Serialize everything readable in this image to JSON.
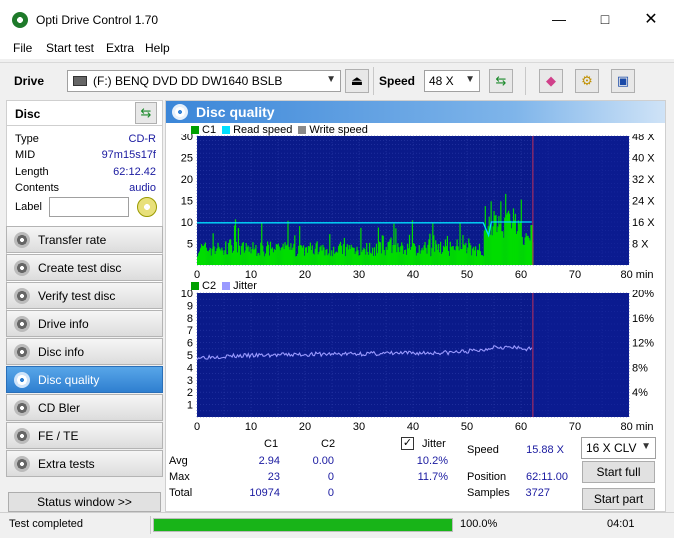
{
  "window": {
    "title": "Opti Drive Control 1.70"
  },
  "menu": [
    "File",
    "Start test",
    "Extra",
    "Help"
  ],
  "toolbar": {
    "drive_label": "Drive",
    "drive_value": "(F:)  BENQ DVD DD DW1640 BSLB",
    "speed_label": "Speed",
    "speed_value": "48 X"
  },
  "disc": {
    "header": "Disc",
    "rows": [
      {
        "key": "Type",
        "value": "CD-R"
      },
      {
        "key": "MID",
        "value": "97m15s17f"
      },
      {
        "key": "Length",
        "value": "62:12.42"
      },
      {
        "key": "Contents",
        "value": "audio"
      }
    ],
    "label_key": "Label",
    "label_value": ""
  },
  "nav": [
    "Transfer rate",
    "Create test disc",
    "Verify test disc",
    "Drive info",
    "Disc info",
    "Disc quality",
    "CD Bler",
    "FE / TE",
    "Extra tests"
  ],
  "nav_active": 5,
  "status_window_label": "Status window >>",
  "panel_title": "Disc quality",
  "legend_top": {
    "c1": "C1",
    "read": "Read speed",
    "write": "Write speed"
  },
  "legend_bottom": {
    "c2": "C2",
    "jitter": "Jitter"
  },
  "colors": {
    "accent": "#2f7fd0",
    "c1": "#00dd00",
    "read_speed": "#00e0ff",
    "jitter": "#9a9aff",
    "plot_bg": "#0a1a8a",
    "progress": "#18b418"
  },
  "chart_data": [
    {
      "type": "area",
      "series": [
        {
          "name": "C1",
          "color": "#00dd00"
        },
        {
          "name": "Read speed",
          "color": "#00e0ff"
        },
        {
          "name": "Write speed",
          "color": "#9a9a9a"
        }
      ],
      "x_ticks": [
        "0",
        "10",
        "20",
        "30",
        "40",
        "50",
        "60",
        "70",
        "80 min"
      ],
      "y_left_ticks": [
        "5",
        "10",
        "15",
        "20",
        "25",
        "30"
      ],
      "y_right_ticks": [
        "8 X",
        "16 X",
        "24 X",
        "32 X",
        "40 X",
        "48 X"
      ],
      "xlim": [
        0,
        80
      ],
      "ylim": [
        0,
        30
      ],
      "disc_end_min": 62.2,
      "c1_summary": {
        "avg": 2.94,
        "max": 23,
        "max_at_min": 55
      },
      "read_speed_x": [
        [
          0,
          15.7
        ],
        [
          53,
          15.7
        ],
        [
          54,
          11.0
        ],
        [
          54.5,
          16.0
        ],
        [
          62,
          16.0
        ]
      ]
    },
    {
      "type": "line",
      "series": [
        {
          "name": "C2",
          "color": "#00dd00"
        },
        {
          "name": "Jitter",
          "color": "#9a9aff"
        }
      ],
      "x_ticks": [
        "0",
        "10",
        "20",
        "30",
        "40",
        "50",
        "60",
        "70",
        "80 min"
      ],
      "y_left_ticks": [
        "1",
        "2",
        "3",
        "4",
        "5",
        "6",
        "7",
        "8",
        "9",
        "10"
      ],
      "y_right_ticks": [
        "4%",
        "8%",
        "12%",
        "16%",
        "20%"
      ],
      "xlim": [
        0,
        80
      ],
      "ylim": [
        0,
        10
      ],
      "disc_end_min": 62.2,
      "jitter_pct": [
        [
          0,
          9.6
        ],
        [
          5,
          9.8
        ],
        [
          10,
          9.9
        ],
        [
          20,
          10.1
        ],
        [
          30,
          10.2
        ],
        [
          40,
          10.3
        ],
        [
          47,
          10.4
        ],
        [
          53,
          10.8
        ],
        [
          55,
          11.4
        ],
        [
          58,
          11.2
        ],
        [
          62,
          10.9
        ]
      ]
    }
  ],
  "stats": {
    "col_c1": "C1",
    "col_c2": "C2",
    "jitter_checkbox": "Jitter",
    "rows": [
      {
        "label": "Avg",
        "c1": "2.94",
        "c2": "0.00",
        "jitter": "10.2%"
      },
      {
        "label": "Max",
        "c1": "23",
        "c2": "0",
        "jitter": "11.7%"
      },
      {
        "label": "Total",
        "c1": "10974",
        "c2": "0",
        "jitter": ""
      }
    ],
    "speed_label": "Speed",
    "speed_value": "15.88 X",
    "position_label": "Position",
    "position_value": "62:11.00",
    "samples_label": "Samples",
    "samples_value": "3727",
    "speed_mode": "16 X CLV",
    "start_full": "Start full",
    "start_part": "Start part"
  },
  "status": {
    "text": "Test completed",
    "progress_pct": 100,
    "progress_text": "100.0%",
    "time": "04:01"
  }
}
